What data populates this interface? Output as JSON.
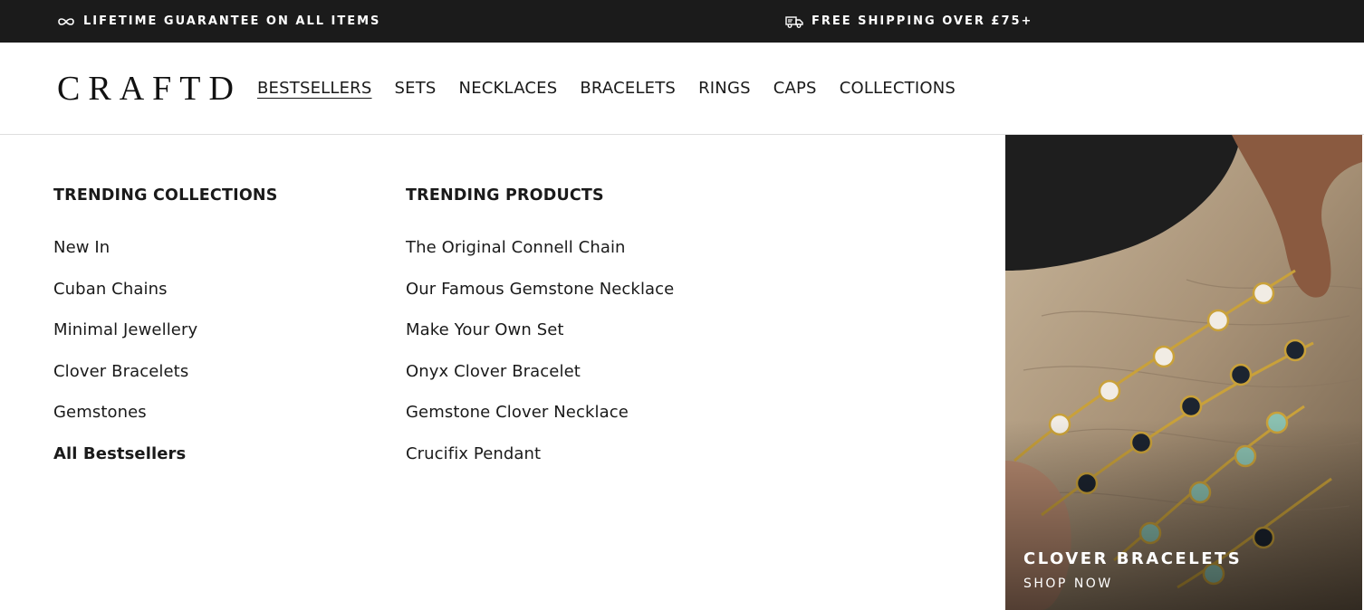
{
  "announcement": {
    "left": {
      "icon": "infinity-icon",
      "text": "LIFETIME GUARANTEE ON ALL ITEMS"
    },
    "right": {
      "icon": "delivery-truck-icon",
      "text": "FREE SHIPPING OVER £75+"
    }
  },
  "header": {
    "logo": "CRAFTD",
    "nav": [
      {
        "label": "BESTSELLERS",
        "active": true
      },
      {
        "label": "SETS"
      },
      {
        "label": "NECKLACES"
      },
      {
        "label": "BRACELETS"
      },
      {
        "label": "RINGS"
      },
      {
        "label": "CAPS"
      },
      {
        "label": "COLLECTIONS"
      }
    ]
  },
  "mega_menu": {
    "collections": {
      "heading": "TRENDING COLLECTIONS",
      "items": [
        "New In",
        "Cuban Chains",
        "Minimal Jewellery",
        "Clover Bracelets",
        "Gemstones",
        "All Bestsellers"
      ]
    },
    "products": {
      "heading": "TRENDING PRODUCTS",
      "items": [
        "The Original Connell Chain",
        "Our Famous Gemstone Necklace",
        "Make Your Own Set",
        "Onyx Clover Bracelet",
        "Gemstone Clover Necklace",
        "Crucifix Pendant"
      ]
    },
    "promo": {
      "title": "CLOVER BRACELETS",
      "cta": "SHOP NOW"
    }
  },
  "colors": {
    "announcement_bg": "#1b1b1b",
    "text": "#1a1a1a",
    "background": "#ffffff"
  }
}
